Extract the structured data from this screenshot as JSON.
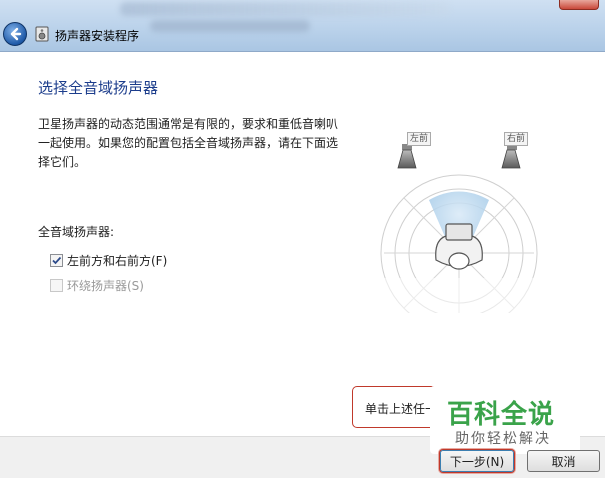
{
  "window": {
    "title": "扬声器安装程序"
  },
  "content": {
    "heading": "选择全音域扬声器",
    "description": "卫星扬声器的动态范围通常是有限的，要求和重低音喇叭一起使用。如果您的配置包括全音域扬声器，请在下面选择它们。",
    "group_label": "全音域扬声器:",
    "options": [
      {
        "label": "左前方和右前方(F)",
        "checked": true,
        "enabled": true
      },
      {
        "label": "环绕扬声器(S)",
        "checked": false,
        "enabled": false
      }
    ],
    "diagram": {
      "left_label": "左前",
      "right_label": "右前"
    }
  },
  "hint": {
    "text": "单击上述任一"
  },
  "footer": {
    "next_label": "下一步(N)",
    "cancel_label": "取消"
  },
  "watermark": {
    "title": "百科全说",
    "subtitle": "助你轻松解决"
  },
  "colors": {
    "heading": "#1c3d8c",
    "highlight": "#c0392b",
    "watermark_green": "#3aa34a"
  }
}
